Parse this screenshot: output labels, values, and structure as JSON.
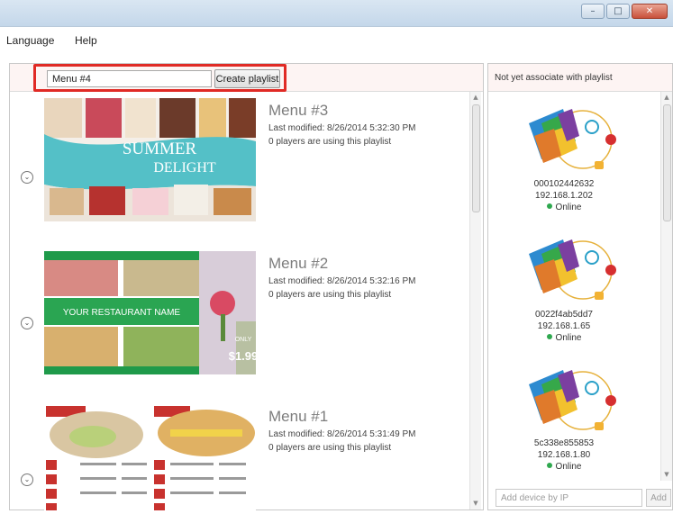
{
  "window": {
    "controls": [
      {
        "name": "minimize",
        "glyph": "–"
      },
      {
        "name": "maximize",
        "glyph": "□"
      },
      {
        "name": "close",
        "glyph": "✕"
      }
    ]
  },
  "menubar": {
    "items": [
      "Language",
      "Help"
    ]
  },
  "playlist_editor": {
    "name_input_value": "Menu #4",
    "create_label": "Create playlist",
    "highlight_color": "#e02a25"
  },
  "playlists": [
    {
      "title": "Menu #3",
      "modified": "Last modified: 8/26/2014 5:32:30 PM",
      "players": "0 players are using this playlist",
      "thumb_text": [
        "SUMMER",
        "DELIGHT"
      ]
    },
    {
      "title": "Menu #2",
      "modified": "Last modified: 8/26/2014 5:32:16 PM",
      "players": "0 players are using this playlist",
      "thumb_text": [
        "YOUR RESTAURANT NAME",
        "ONLY",
        "$1.99"
      ]
    },
    {
      "title": "Menu #1",
      "modified": "Last modified: 8/26/2014 5:31:49 PM",
      "players": "0 players are using this playlist",
      "thumb_text": []
    }
  ],
  "devices_panel": {
    "header": "Not yet associate with playlist",
    "devices": [
      {
        "id": "000102442632",
        "ip": "192.168.1.202",
        "status": "Online"
      },
      {
        "id": "0022f4ab5dd7",
        "ip": "192.168.1.65",
        "status": "Online"
      },
      {
        "id": "5c338e855853",
        "ip": "192.168.1.80",
        "status": "Online"
      }
    ],
    "add_placeholder": "Add device by IP",
    "add_label": "Add"
  },
  "colors": {
    "online": "#2fa84f",
    "titlebar": "#c4d7ea"
  },
  "icons": [
    "chevron-down-icon",
    "device-player-icon",
    "online-status-icon"
  ]
}
